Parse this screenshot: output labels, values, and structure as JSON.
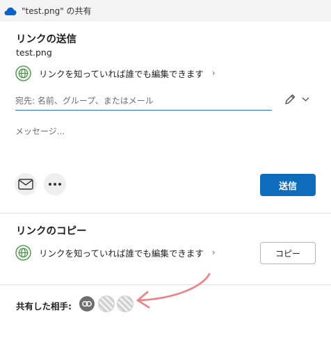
{
  "window": {
    "title": "\"test.png\" の共有"
  },
  "send_section": {
    "title": "リンクの送信",
    "filename": "test.png",
    "permission": "リンクを知っていれば誰でも編集できます",
    "to_placeholder": "宛先: 名前、グループ、またはメール",
    "message_placeholder": "メッセージ...",
    "send_label": "送信"
  },
  "copy_section": {
    "title": "リンクのコピー",
    "permission": "リンクを知っていれば誰でも編集できます",
    "copy_label": "コピー"
  },
  "shared_with": {
    "label": "共有した相手:"
  },
  "colors": {
    "accent": "#0f6cbd",
    "globe": "#3a8c3a",
    "arrow": "#e8878a",
    "onedrive": "#0a64c8"
  },
  "icons": [
    "onedrive-cloud-icon",
    "globe-icon",
    "chevron-right-icon",
    "pencil-icon",
    "chevron-down-icon",
    "mail-icon",
    "more-icon",
    "link-icon"
  ]
}
